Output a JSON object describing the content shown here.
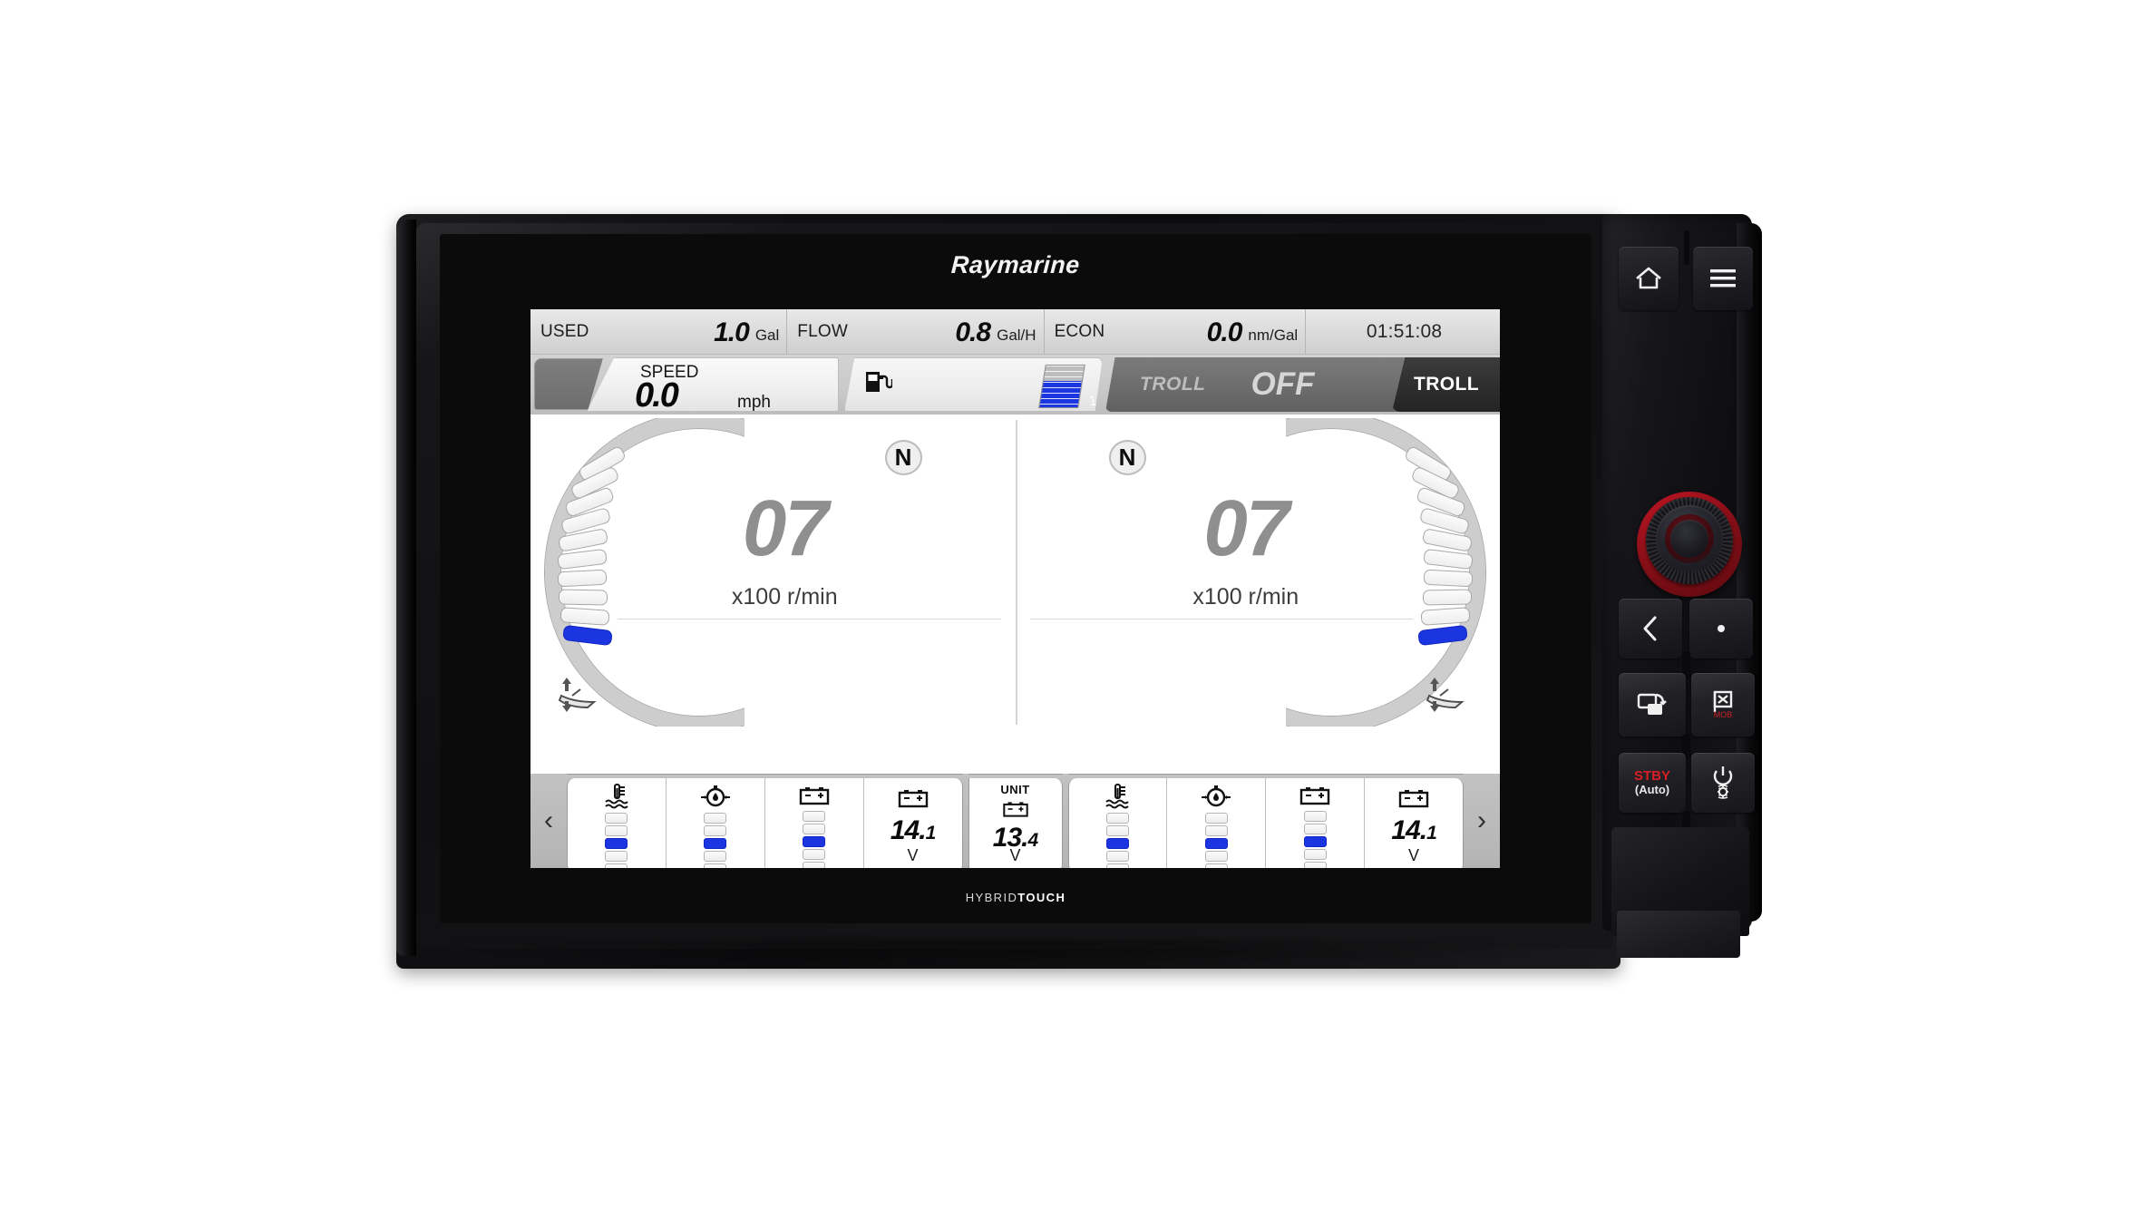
{
  "device": {
    "brand": "Raymarine",
    "touch_brand_light": "HYBRID",
    "touch_brand_bold": "TOUCH"
  },
  "top_strip": {
    "cells": [
      {
        "label": "USED",
        "value": "1.0",
        "unit": "Gal"
      },
      {
        "label": "FLOW",
        "value": "0.8",
        "unit": "Gal/H"
      },
      {
        "label": "ECON",
        "value": "0.0",
        "unit": "nm/Gal"
      }
    ],
    "clock": "01:51:08"
  },
  "speed_row": {
    "speed_label": "SPEED",
    "speed_value": "0.0",
    "speed_unit": "mph",
    "fuel_icon": "fuel-pump-icon",
    "tank_number": "1",
    "tank_fill_percent": 62,
    "troll_label": "TROLL",
    "troll_state": "OFF",
    "troll_button": "TROLL"
  },
  "engines": [
    {
      "side": "left",
      "gear": "N",
      "rpm": "07",
      "rpm_unit": "x100 r/min",
      "trim_segments": 10,
      "trim_active_index": 9,
      "trim_icon": "boat-trim-icon"
    },
    {
      "side": "right",
      "gear": "N",
      "rpm": "07",
      "rpm_unit": "x100 r/min",
      "trim_segments": 10,
      "trim_active_index": 9,
      "trim_icon": "boat-trim-icon"
    }
  ],
  "bottom_bar": {
    "prev_arrow": "‹",
    "next_arrow": "›",
    "left_group": [
      {
        "icon": "coolant-temp-icon",
        "type": "bargraph",
        "segments": 5,
        "active_index": 2
      },
      {
        "icon": "oil-pressure-icon",
        "type": "bargraph",
        "segments": 5,
        "active_index": 2
      },
      {
        "icon": "battery-icon",
        "type": "bargraph",
        "segments": 5,
        "active_index": 2
      },
      {
        "icon": "battery-icon",
        "type": "value",
        "value": "14.",
        "value_small": "1",
        "unit": "V"
      }
    ],
    "unit_tile": {
      "label": "UNIT",
      "icon": "battery-icon",
      "value": "13.",
      "value_small": "4",
      "unit": "V"
    },
    "right_group": [
      {
        "icon": "coolant-temp-icon",
        "type": "bargraph",
        "segments": 5,
        "active_index": 2
      },
      {
        "icon": "oil-pressure-icon",
        "type": "bargraph",
        "segments": 5,
        "active_index": 2
      },
      {
        "icon": "battery-icon",
        "type": "bargraph",
        "segments": 5,
        "active_index": 2
      },
      {
        "icon": "battery-icon",
        "type": "value",
        "value": "14.",
        "value_small": "1",
        "unit": "V"
      }
    ]
  },
  "bezel_buttons": {
    "home": "home-icon",
    "menu": "menu-icon",
    "uniball": "rotary-dial",
    "back": "back-chevron-icon",
    "ok": "ok-dot-icon",
    "switch_app": "switch-app-icon",
    "mob": "man-overboard-icon",
    "standby": "STBY",
    "standby_sub": "(Auto)",
    "power": "power-brightness-icon"
  },
  "colors": {
    "accent_blue": "#1b35e0",
    "alert_red": "#d81f27",
    "dial_red": "#b01420"
  }
}
